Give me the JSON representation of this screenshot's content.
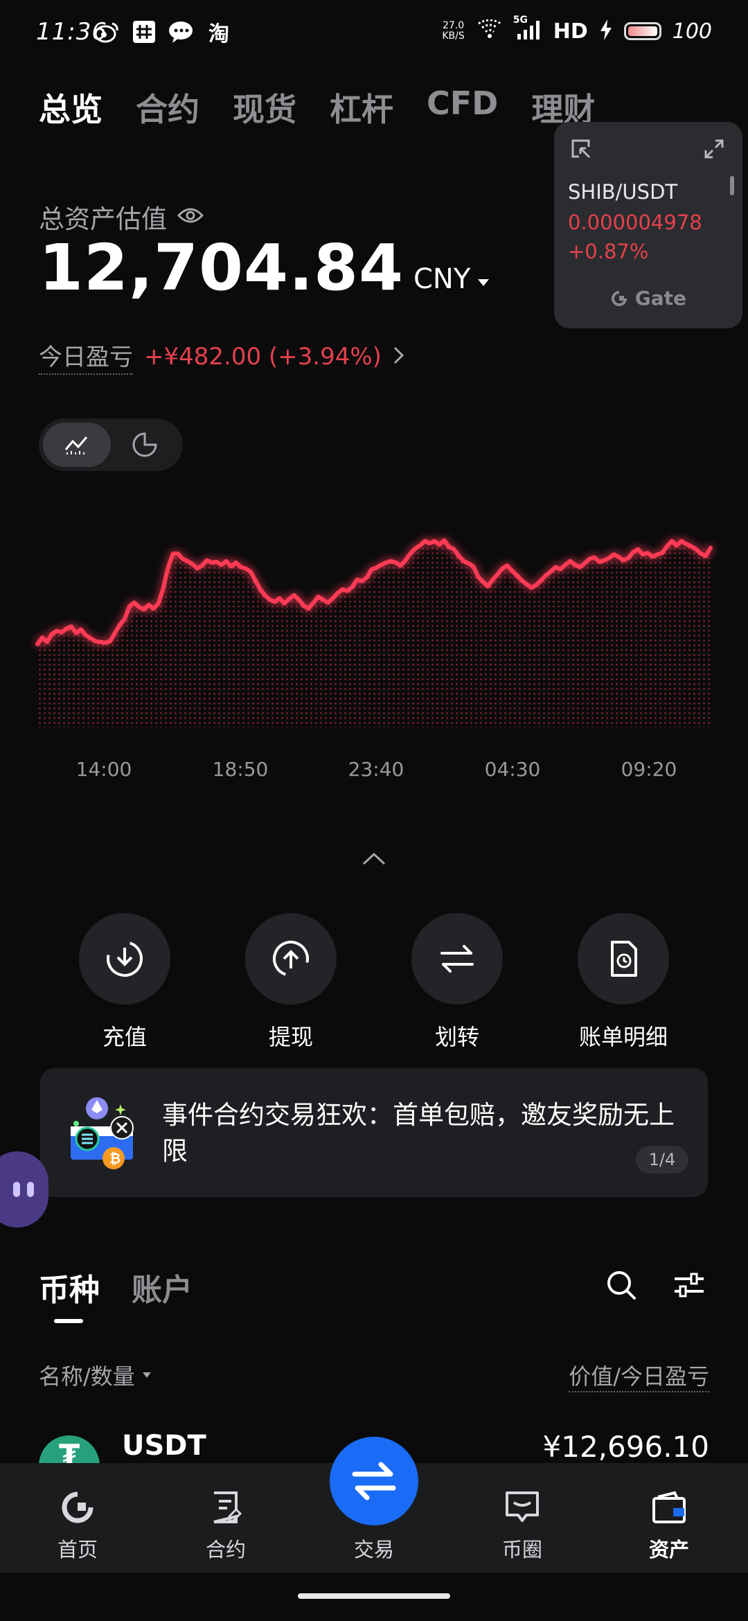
{
  "status_bar": {
    "time": "11:36",
    "apps": [
      "weibo-icon",
      "hash-icon",
      "wechat-icon",
      "taobao-icon"
    ],
    "taobao_glyph": "淘",
    "net_speed_value": "27.0",
    "net_speed_unit": "KB/S",
    "network": "5G",
    "hd": "HD",
    "battery_level": "100"
  },
  "top_tabs": [
    {
      "label": "总览",
      "active": true
    },
    {
      "label": "合约",
      "active": false
    },
    {
      "label": "现货",
      "active": false
    },
    {
      "label": "杠杆",
      "active": false
    },
    {
      "label": "CFD",
      "active": false
    },
    {
      "label": "理财",
      "active": false
    }
  ],
  "float_widget": {
    "pair": "SHIB/USDT",
    "price": "0.000004978",
    "change": "+0.87%",
    "brand": "Gate",
    "color": "#e5414d"
  },
  "asset": {
    "label": "总资产估值",
    "value": "12,704.84",
    "currency": "CNY",
    "pnl_label": "今日盈亏",
    "pnl_value": "+¥482.00 (+3.94%)"
  },
  "chart_data": {
    "type": "line",
    "color": "#ff3b55",
    "x_ticks": [
      "14:00",
      "18:50",
      "23:40",
      "04:30",
      "09:20"
    ],
    "values": [
      150,
      159,
      153,
      164,
      168,
      166,
      171,
      174,
      165,
      170,
      162,
      158,
      154,
      153,
      152,
      154,
      165,
      176,
      184,
      201,
      206,
      200,
      197,
      203,
      198,
      205,
      226,
      254,
      272,
      272,
      265,
      262,
      258,
      252,
      256,
      263,
      260,
      261,
      257,
      262,
      255,
      260,
      254,
      252,
      248,
      236,
      224,
      216,
      210,
      207,
      212,
      205,
      211,
      216,
      210,
      202,
      198,
      206,
      214,
      210,
      206,
      212,
      219,
      224,
      222,
      227,
      237,
      235,
      240,
      251,
      253,
      257,
      260,
      262,
      260,
      256,
      263,
      272,
      279,
      283,
      289,
      286,
      289,
      284,
      290,
      281,
      278,
      269,
      262,
      259,
      255,
      241,
      234,
      228,
      237,
      244,
      252,
      256,
      249,
      243,
      236,
      231,
      226,
      230,
      236,
      243,
      248,
      254,
      251,
      257,
      262,
      257,
      254,
      259,
      265,
      267,
      261,
      263,
      266,
      271,
      268,
      263,
      266,
      274,
      278,
      271,
      273,
      268,
      271,
      273,
      282,
      289,
      283,
      289,
      285,
      282,
      278,
      272,
      269,
      280
    ]
  },
  "chart_toggle": {
    "line_icon": "line-chart-icon",
    "pie_icon": "pie-chart-icon"
  },
  "actions": [
    {
      "label": "充值",
      "icon": "deposit-icon"
    },
    {
      "label": "提现",
      "icon": "withdraw-icon"
    },
    {
      "label": "划转",
      "icon": "transfer-icon"
    },
    {
      "label": "账单明细",
      "icon": "bill-icon"
    }
  ],
  "banner": {
    "text": "事件合约交易狂欢：首单包赔，邀友奖励无上限",
    "pager": "1/4"
  },
  "holdings": {
    "tabs": [
      {
        "label": "币种",
        "active": true
      },
      {
        "label": "账户",
        "active": false
      }
    ],
    "col_left": "名称/数量",
    "col_right": "价值/今日盈亏",
    "rows": [
      {
        "symbol": "USDT",
        "logo_glyph": "₮",
        "value": "¥12,696.10"
      }
    ]
  },
  "bottom_nav": [
    {
      "label": "首页",
      "icon": "home-icon",
      "active": false
    },
    {
      "label": "合约",
      "icon": "contract-icon",
      "active": false
    },
    {
      "label": "交易",
      "icon": "trade-icon",
      "active": false
    },
    {
      "label": "币圈",
      "icon": "community-icon",
      "active": false
    },
    {
      "label": "资产",
      "icon": "wallet-icon",
      "active": true
    }
  ]
}
